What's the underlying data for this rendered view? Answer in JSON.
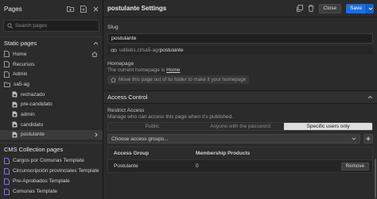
{
  "left": {
    "title": "Pages",
    "search_placeholder": "Search pages",
    "static_section": "Static pages",
    "pages": [
      {
        "label": "Home",
        "sub": false,
        "icon": "page-icon",
        "selected": false
      },
      {
        "label": "Recursos",
        "sub": false,
        "icon": "page-icon",
        "selected": false
      },
      {
        "label": "Admin",
        "sub": false,
        "icon": "page-icon",
        "selected": false
      },
      {
        "label": "sa5-ag",
        "sub": false,
        "icon": "folder-icon",
        "selected": false
      },
      {
        "label": "rechazado",
        "sub": true,
        "icon": "locked-page-icon",
        "selected": false
      },
      {
        "label": "pre-candidato",
        "sub": true,
        "icon": "locked-page-icon",
        "selected": false
      },
      {
        "label": "admin",
        "sub": true,
        "icon": "locked-page-icon",
        "selected": false
      },
      {
        "label": "candidato",
        "sub": true,
        "icon": "locked-page-icon",
        "selected": false
      },
      {
        "label": "postulante",
        "sub": true,
        "icon": "locked-page-icon",
        "selected": true
      }
    ],
    "cms_section": "CMS Collection pages",
    "cms_pages": [
      {
        "label": "Cargos por Comunas Template"
      },
      {
        "label": "Circunscripción provinciales Template"
      },
      {
        "label": "Pre-Aprobados Template"
      },
      {
        "label": "Comunas Template"
      }
    ]
  },
  "right": {
    "title": "postulante Settings",
    "close_label": "Close",
    "save_label": "Save",
    "slug_label": "Slug",
    "slug_value": "postulante",
    "url_prefix": "udilabs.cl/sa5-ag/",
    "url_tail": "postulante",
    "homepage_label": "Homepage",
    "homepage_text": "The current homepage is",
    "homepage_link": "Home",
    "move_text": "Move this page out of its folder to make it your homepage",
    "access_title": "Access Control",
    "restrict_label": "Restrict Access",
    "restrict_desc": "Manage who can access this page when it's published.",
    "segments": [
      {
        "label": "Public",
        "on": false
      },
      {
        "label": "Anyone with the password",
        "on": false
      },
      {
        "label": "Specific users only",
        "on": true
      }
    ],
    "group_placeholder": "Choose access groups...",
    "table": {
      "headers": [
        "Access Group",
        "Membership Products"
      ],
      "rows": [
        {
          "group": "Postulante",
          "products": "0",
          "action": "Remove"
        }
      ]
    }
  }
}
